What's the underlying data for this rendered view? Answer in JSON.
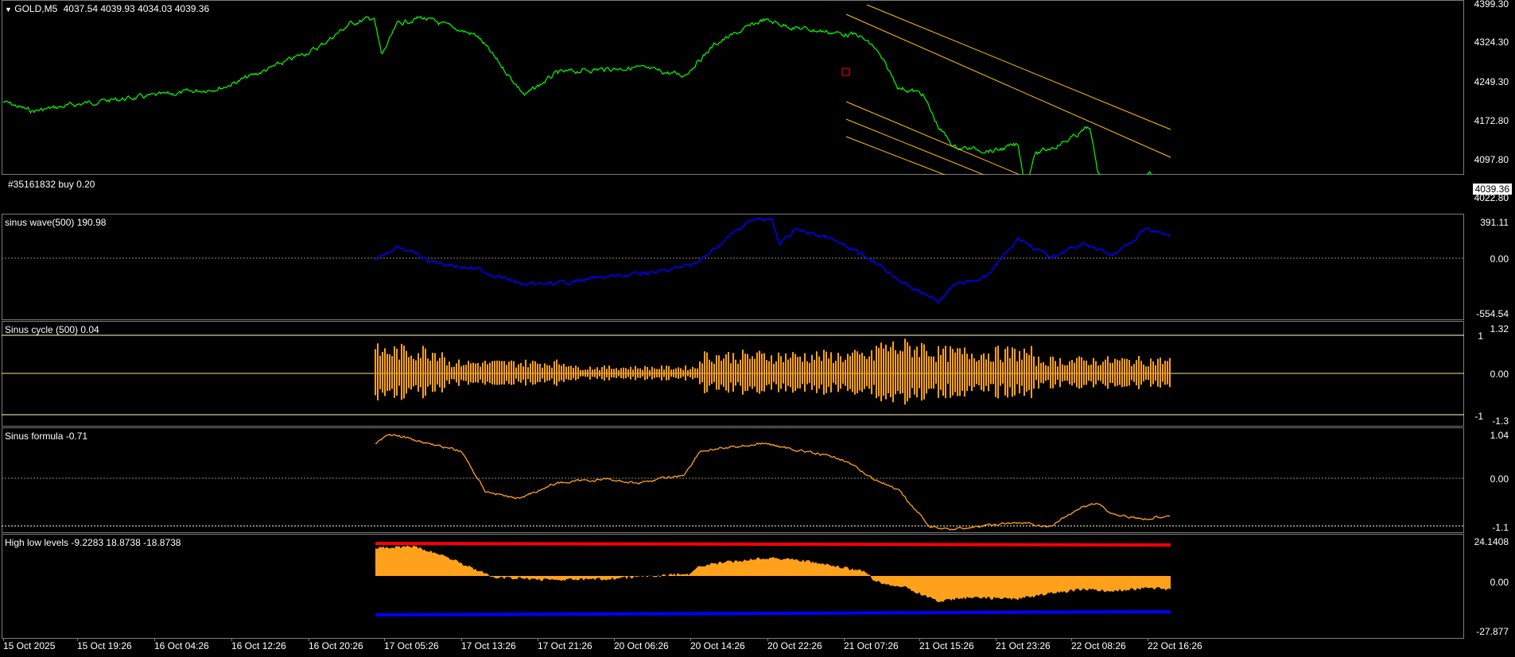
{
  "main": {
    "title": "GOLD,M5",
    "ohlc": "4037.54 4039.93 4034.03 4039.36",
    "order_label": "#35161832 buy 0.20",
    "current_price": "4039.36",
    "y_labels": [
      "4399.30",
      "4324.30",
      "4249.30",
      "4172.80",
      "4097.80",
      "4022.80"
    ]
  },
  "sinus_wave": {
    "label": "sinus wave(500) 190.98",
    "y_labels": [
      "391.11",
      "0.00",
      "-554.54"
    ]
  },
  "sinus_cycle": {
    "label": "Sinus cycle (500) 0.04",
    "y_labels": [
      "1.32",
      "1",
      "0.00",
      "-1",
      "-1.3"
    ]
  },
  "sinus_formula": {
    "label": "Sinus formula -0.71",
    "y_labels": [
      "1.04",
      "0.00",
      "-1.1"
    ]
  },
  "high_low": {
    "label": "High low levels -9.2283 18.8738 -18.8738",
    "y_labels": [
      "24.1408",
      "0.00",
      "-27.877"
    ]
  },
  "x_labels": [
    "15 Oct 2025",
    "15 Oct 19:26",
    "16 Oct 04:26",
    "16 Oct 12:26",
    "16 Oct 20:26",
    "17 Oct 05:26",
    "17 Oct 13:26",
    "17 Oct 21:26",
    "20 Oct 06:26",
    "20 Oct 14:26",
    "20 Oct 22:26",
    "21 Oct 07:26",
    "21 Oct 15:26",
    "21 Oct 23:26",
    "22 Oct 08:26",
    "22 Oct 16:26"
  ],
  "colors": {
    "price": "#00ff00",
    "wave": "#0000ff",
    "cycle": "#ffa11a",
    "formula": "#ffa11a",
    "high": "#ff0000",
    "low": "#0000ff",
    "channel": "#ffc000"
  }
}
